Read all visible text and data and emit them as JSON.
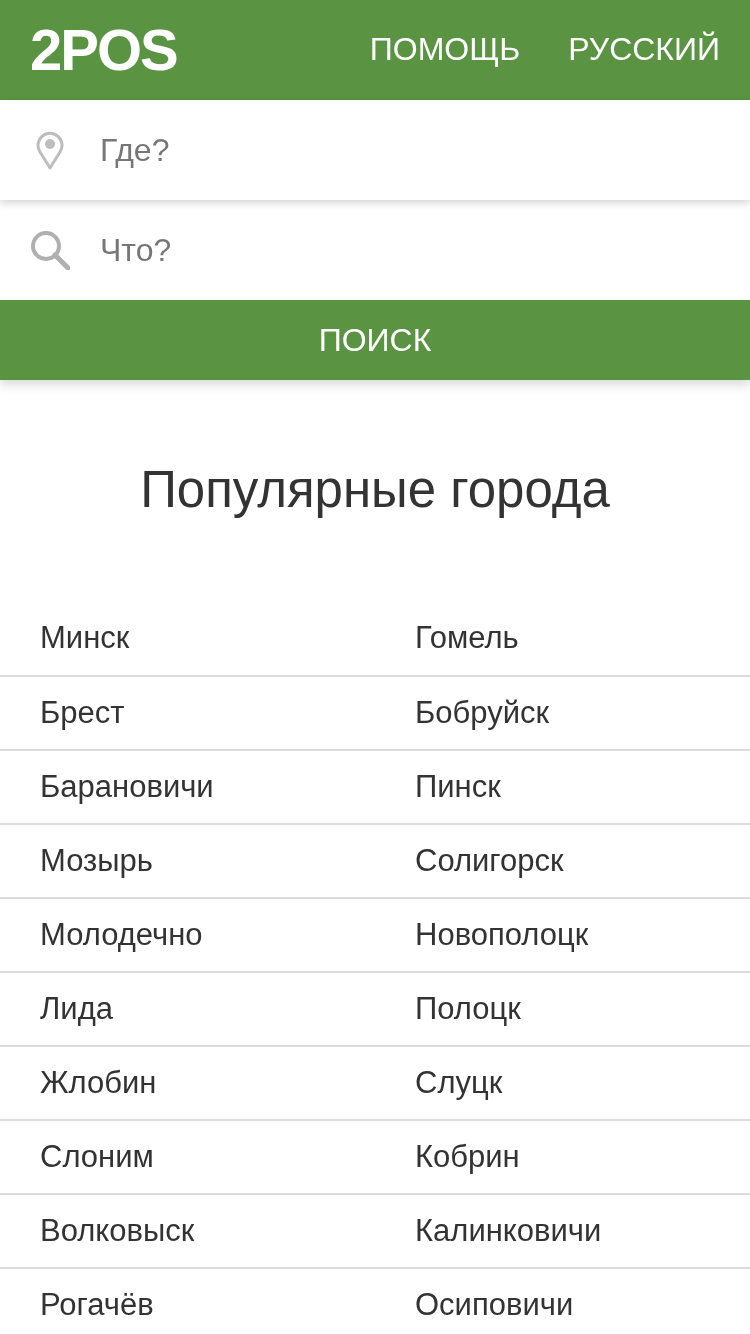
{
  "header": {
    "logo": "2POS",
    "nav": [
      {
        "label": "ПОМОЩЬ"
      },
      {
        "label": "РУССКИЙ"
      }
    ]
  },
  "search": {
    "fields": [
      {
        "kind": "location",
        "placeholder": "Где?"
      },
      {
        "kind": "query",
        "placeholder": "Что?"
      }
    ],
    "button": "ПОИСК"
  },
  "popular": {
    "title": "Популярные города",
    "cities": [
      "Минск",
      "Гомель",
      "Брест",
      "Бобруйск",
      "Барановичи",
      "Пинск",
      "Мозырь",
      "Солигорск",
      "Молодечно",
      "Новополоцк",
      "Лида",
      "Полоцк",
      "Жлобин",
      "Слуцк",
      "Слоним",
      "Кобрин",
      "Волковыск",
      "Калинковичи",
      "Рогачёв",
      "Осиповичи"
    ]
  }
}
